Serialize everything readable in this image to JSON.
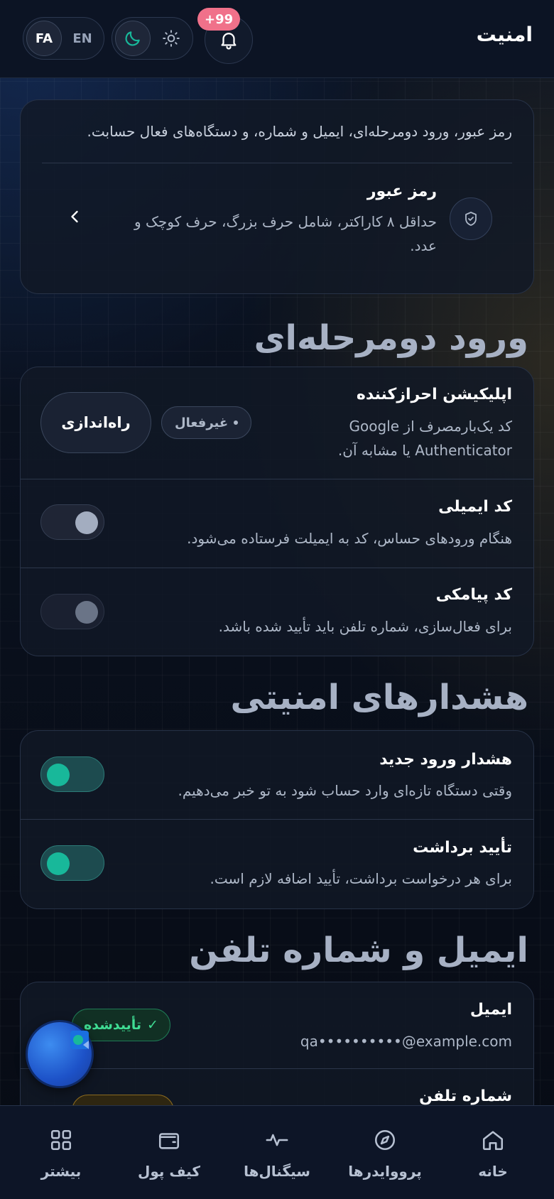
{
  "header": {
    "title": "امنیت",
    "lang_fa": "FA",
    "lang_en": "EN",
    "notification_count": "+99"
  },
  "intro": {
    "text": "رمز عبور، ورود دومرحله‌ای، ایمیل و شماره، و دستگاه‌های فعال حسابت.",
    "password_title": "رمز عبور",
    "password_desc": "حداقل ۸ کاراکتر، شامل حرف بزرگ، حرف کوچک و عدد."
  },
  "two_factor": {
    "section_title": "ورود دومرحله‌ای",
    "authenticator_title": "اپلیکیشن احرازکننده",
    "authenticator_desc": "کد یک‌بارمصرف از Google Authenticator یا مشابه آن.",
    "authenticator_status": "غیرفعال",
    "setup_label": "راه‌اندازی",
    "email_code_title": "کد ایمیلی",
    "email_code_desc": "هنگام ورودهای حساس، کد به ایمیلت فرستاده می‌شود.",
    "email_code_enabled": false,
    "sms_code_title": "کد پیامکی",
    "sms_code_desc": "برای فعال‌سازی، شماره تلفن باید تأیید شده باشد.",
    "sms_code_enabled": false
  },
  "alerts": {
    "section_title": "هشدارهای امنیتی",
    "new_login_title": "هشدار ورود جدید",
    "new_login_desc": "وقتی دستگاه تازه‌ای وارد حساب شود به تو خبر می‌دهیم.",
    "new_login_enabled": true,
    "withdraw_title": "تأیید برداشت",
    "withdraw_desc": "برای هر درخواست برداشت، تأیید اضافه لازم است.",
    "withdraw_enabled": true
  },
  "contact": {
    "section_title": "ایمیل و شماره تلفن",
    "email_title": "ایمیل",
    "email_value": "qa••••••••••@example.com",
    "email_status": "تأییدشده",
    "phone_title": "شماره تلفن"
  },
  "nav": {
    "home": "خانه",
    "providers": "پرووایدرها",
    "signals": "سیگنال‌ها",
    "wallet": "کیف پول",
    "more": "بیشتر"
  },
  "colors": {
    "accent_teal": "#18b89a",
    "badge_pink": "#f0718a",
    "verified_green": "#3fdc93"
  }
}
